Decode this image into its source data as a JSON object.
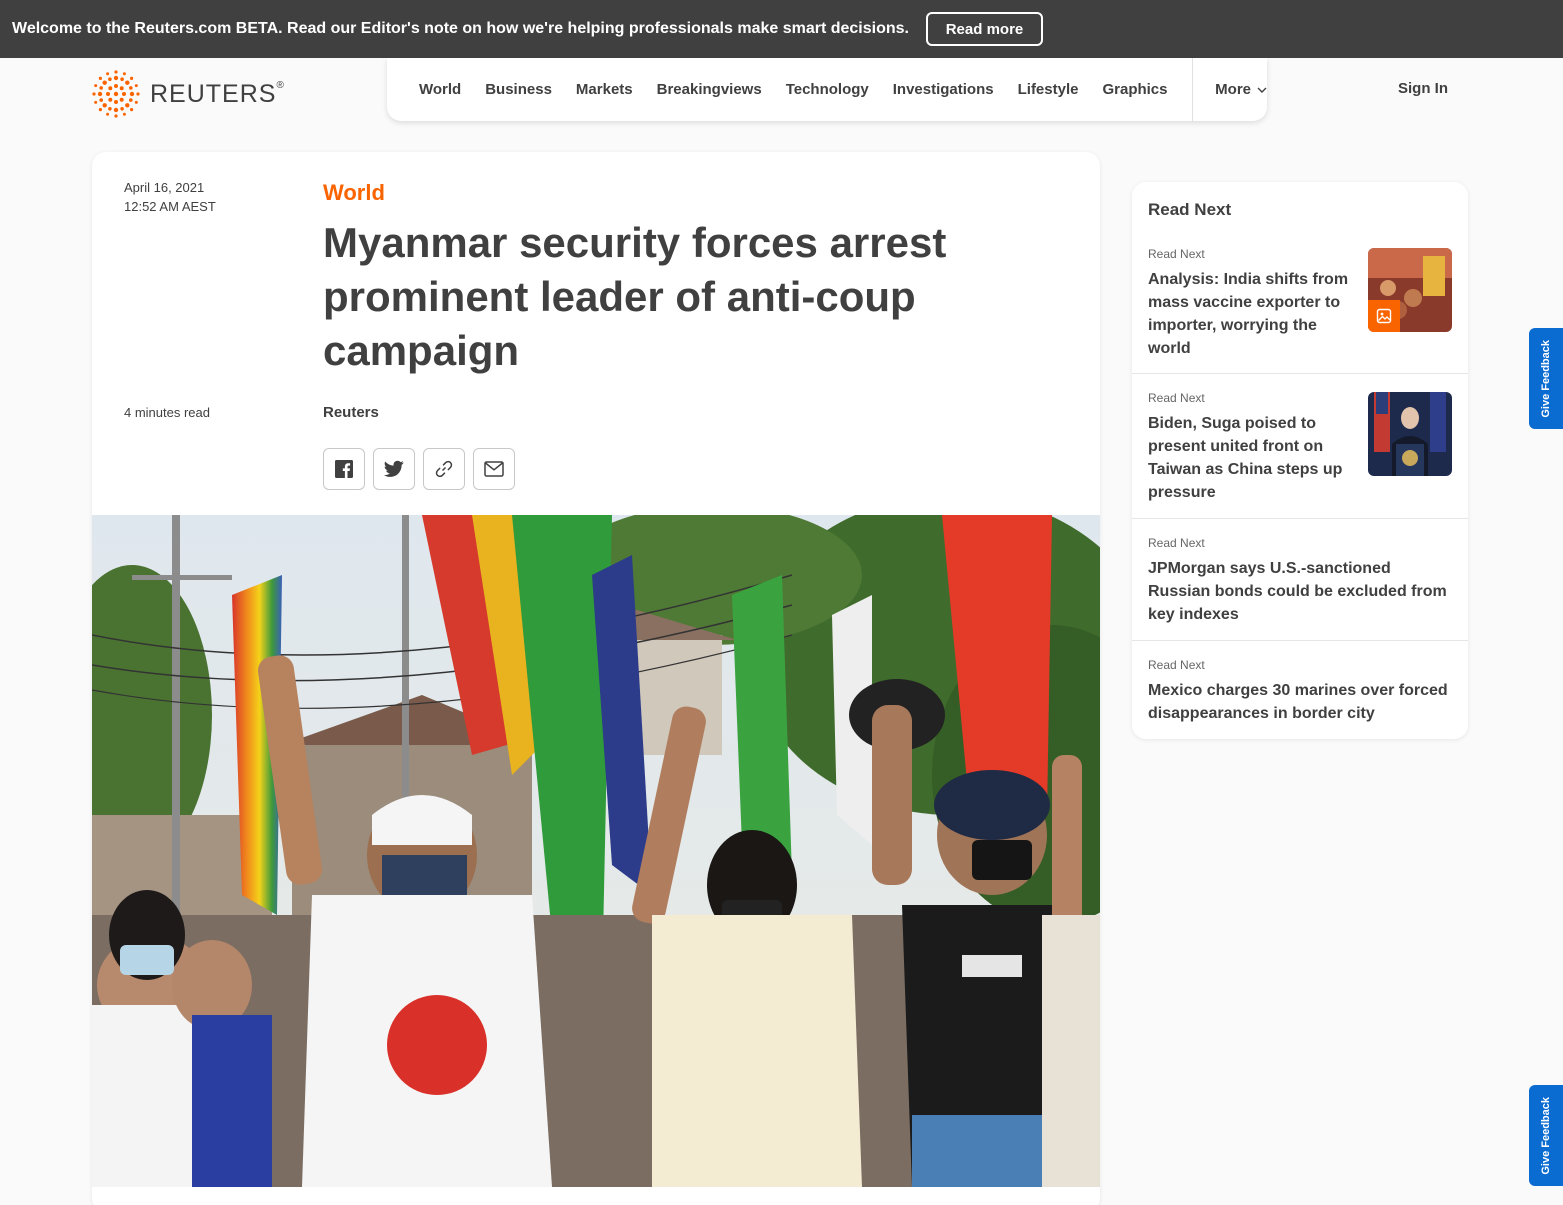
{
  "banner": {
    "text": "Welcome to the Reuters.com BETA. Read our Editor's note on how we're helping professionals make smart decisions.",
    "button": "Read more"
  },
  "header": {
    "logo_text": "REUTERS",
    "logo_mark": "®",
    "nav": [
      "World",
      "Business",
      "Markets",
      "Breakingviews",
      "Technology",
      "Investigations",
      "Lifestyle",
      "Graphics"
    ],
    "more": "More",
    "sign_in": "Sign In"
  },
  "article": {
    "date": "April 16, 2021",
    "time": "12:52 AM AEST",
    "read_time": "4 minutes read",
    "section": "World",
    "headline": "Myanmar security forces arrest prominent leader of anti-coup campaign",
    "byline": "Reuters",
    "share_icons": [
      "facebook-icon",
      "twitter-icon",
      "link-icon",
      "email-icon"
    ]
  },
  "read_next": {
    "title": "Read Next",
    "items": [
      {
        "kicker": "Read Next",
        "headline": "Analysis: India shifts from mass vaccine exporter to importer, worrying the world"
      },
      {
        "kicker": "Read Next",
        "headline": "Biden, Suga poised to present united front on Taiwan as China steps up pressure"
      },
      {
        "kicker": "Read Next",
        "headline": "JPMorgan says U.S.-sanctioned Russian bonds could be excluded from key indexes"
      },
      {
        "kicker": "Read Next",
        "headline": "Mexico charges 30 marines over forced disappearances in border city"
      }
    ]
  },
  "feedback_label": "Give Feedback",
  "colors": {
    "accent": "#fa6400",
    "banner_bg": "#404040",
    "feedback": "#0a6bd1"
  }
}
